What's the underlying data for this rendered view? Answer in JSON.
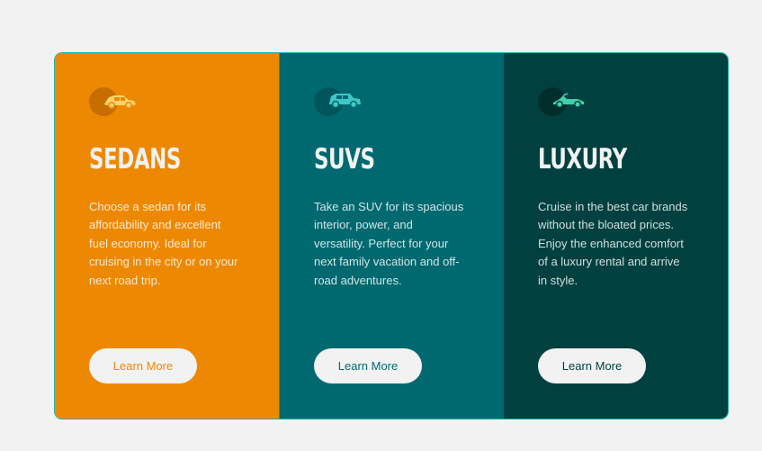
{
  "cards": [
    {
      "id": "sedans",
      "icon": "sedan-car-icon",
      "title": "SEDANS",
      "description": "Choose a sedan for its affordability and excellent fuel economy. Ideal for cruising in the city or on your next road trip.",
      "button_label": "Learn More",
      "background": "#ed8803",
      "icon_color": "#ffd36b",
      "circle_color": "#c86e00"
    },
    {
      "id": "suvs",
      "icon": "suv-car-icon",
      "title": "SUVS",
      "description": "Take an SUV for its spacious interior, power, and versatility. Perfect for your next family vacation and off-road adventures.",
      "button_label": "Learn More",
      "background": "#006970",
      "icon_color": "#3ec6c6",
      "circle_color": "#00555b"
    },
    {
      "id": "luxury",
      "icon": "luxury-car-icon",
      "title": "LUXURY",
      "description": "Cruise in the best car brands without the bloated prices. Enjoy the enhanced comfort of a luxury rental and arrive in style.",
      "button_label": "Learn More",
      "background": "#004140",
      "icon_color": "#3fd1a8",
      "circle_color": "#002e2d"
    }
  ]
}
